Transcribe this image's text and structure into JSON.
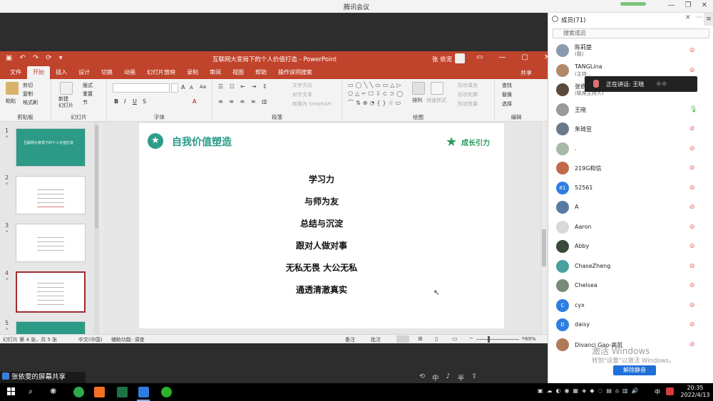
{
  "meeting": {
    "title": "腾讯会议",
    "controls": [
      "—",
      "❐",
      "✕"
    ]
  },
  "ppt": {
    "quick_access": [
      "▣",
      "↶",
      "↷",
      "⟳",
      "▾"
    ],
    "doc_title": "互联网大变局下的个人价值打造 - PowerPoint",
    "user": "张 依宠",
    "window_controls": [
      "▭",
      "—",
      "▢",
      "✕"
    ],
    "tabs": [
      "文件",
      "开始",
      "插入",
      "设计",
      "切换",
      "动画",
      "幻灯片放映",
      "录制",
      "审阅",
      "视图",
      "帮助",
      "操作说明搜索"
    ],
    "share": "共享",
    "ribbon": {
      "clipboard": {
        "label": "剪贴板",
        "paste": "粘贴",
        "cut": "剪切",
        "copy": "复制",
        "format_painter": "格式刷"
      },
      "slides": {
        "label": "幻灯片",
        "new_slide": "新建\n幻灯片",
        "layout": "版式",
        "reset": "重置",
        "section": "节"
      },
      "font": {
        "label": "字体",
        "bold": "B",
        "italic": "I",
        "underline": "U",
        "strike": "S",
        "grow": "A",
        "shrink": "A",
        "clear": "Aa",
        "color": "A"
      },
      "paragraph": {
        "label": "段落",
        "text_dir": "文字方向",
        "align_text": "对齐文本",
        "smartart": "转换为 SmartArt"
      },
      "drawing": {
        "label": "绘图",
        "arrange": "排列",
        "quick_styles": "快速样式",
        "fill": "形状填充",
        "outline": "形状轮廓",
        "effects": "形状效果"
      },
      "editing": {
        "label": "编辑",
        "find": "查找",
        "replace": "替换",
        "select": "选择"
      }
    },
    "thumbnails": [
      {
        "num": "1",
        "text": "互联网大变局下的个人价值打造"
      },
      {
        "num": "2",
        "text": ""
      },
      {
        "num": "3",
        "text": ""
      },
      {
        "num": "4",
        "text": ""
      },
      {
        "num": "5",
        "text": ""
      }
    ],
    "slide": {
      "title": "自我价值塑造",
      "brand": "成长引力",
      "items": [
        "学习力",
        "与师为友",
        "总结与沉淀",
        "跟对人做对事",
        "无私无畏 大公无私",
        "通透清澈真实"
      ]
    },
    "status": {
      "slide_info": "幻灯片 第 4 张，共 5 张",
      "language": "中文(中国)",
      "accessibility": "辅助功能: 调查",
      "notes": "备注",
      "comments": "批注",
      "zoom": "89%"
    }
  },
  "share_label": "张依雯的屏幕共享",
  "float_tools": [
    "⟲",
    "中",
    "♪",
    "半",
    "⇪"
  ],
  "panel": {
    "title": "成员(71)",
    "search_placeholder": "搜索成员",
    "controls": [
      "✕",
      "⋯",
      "⇅"
    ],
    "members": [
      {
        "name": "陈莉楚",
        "sub": "(我)",
        "avatar": "",
        "color": "#8a9bb0",
        "mic": "off"
      },
      {
        "name": "TANGLina",
        "sub": "(主持...",
        "avatar": "",
        "color": "#b08a6a",
        "mic": "off"
      },
      {
        "name": "张依雯",
        "sub": "(联席主持人)",
        "avatar": "",
        "color": "#5a4a3a",
        "mic": "off"
      },
      {
        "name": "王晓",
        "sub": "",
        "avatar": "",
        "color": "#9a9a9a",
        "mic": "on"
      },
      {
        "name": "朱琦昱",
        "sub": "",
        "avatar": "",
        "color": "#6a7a8a",
        "mic": "off"
      },
      {
        "name": ".",
        "sub": "",
        "avatar": "",
        "color": "#a8b8a8",
        "mic": "off"
      },
      {
        "name": "219G和信",
        "sub": "",
        "avatar": "",
        "color": "#c06a4a",
        "mic": "off"
      },
      {
        "name": "52561",
        "sub": "",
        "avatar": "61",
        "color": "#2f7de1",
        "mic": "off"
      },
      {
        "name": "A",
        "sub": "",
        "avatar": "",
        "color": "#5a7aa0",
        "mic": "off"
      },
      {
        "name": "Aaron",
        "sub": "",
        "avatar": "",
        "color": "#d8d8d8",
        "mic": "off"
      },
      {
        "name": "Abby",
        "sub": "",
        "avatar": "",
        "color": "#3a4a3a",
        "mic": "off"
      },
      {
        "name": "ChaseZheng",
        "sub": "",
        "avatar": "",
        "color": "#4aa0a0",
        "mic": "off"
      },
      {
        "name": "Chelsea",
        "sub": "",
        "avatar": "",
        "color": "#7a8a7a",
        "mic": "off"
      },
      {
        "name": "cyx",
        "sub": "",
        "avatar": "C",
        "color": "#2f7de1",
        "mic": "off"
      },
      {
        "name": "daisy",
        "sub": "",
        "avatar": "D",
        "color": "#2f7de1",
        "mic": "off"
      },
      {
        "name": "Divanci Gao-高凯",
        "sub": "",
        "avatar": "",
        "color": "#b07a5a",
        "mic": "off"
      }
    ],
    "speaking": "正在讲话: 王晓",
    "mute_all": "解除静音",
    "activate_title": "激活 Windows",
    "activate_sub": "转到\"设置\"以激活 Windows。"
  },
  "taskbar": {
    "tray": [
      "▣",
      "☁",
      "◐",
      "◉",
      "▦",
      "◈",
      "◆",
      "◌",
      "▤",
      "⌂",
      "▥",
      "🔊"
    ],
    "ime": "中",
    "time": "20:35",
    "date": "2022/4/13"
  }
}
